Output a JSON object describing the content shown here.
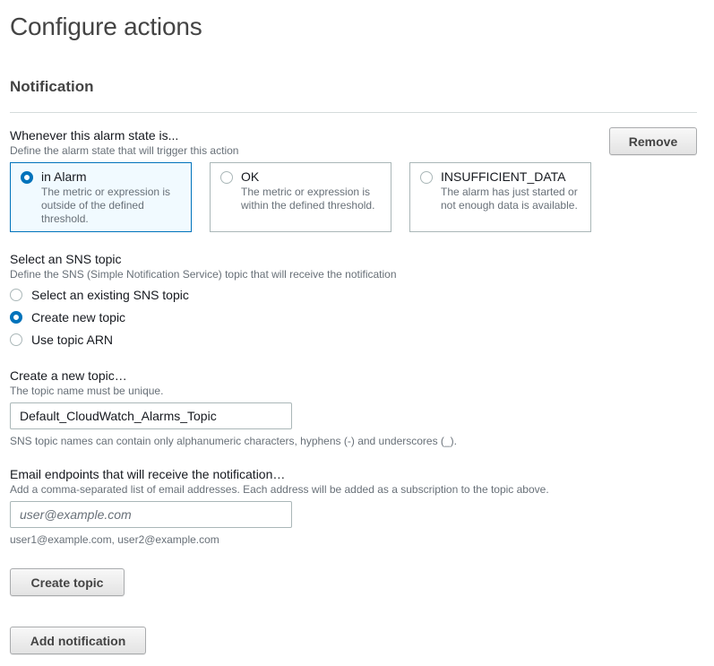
{
  "page": {
    "title": "Configure actions"
  },
  "notification": {
    "section_title": "Notification",
    "remove_label": "Remove",
    "alarm_state": {
      "label": "Whenever this alarm state is...",
      "description": "Define the alarm state that will trigger this action",
      "selected": "in Alarm",
      "options": [
        {
          "title": "in Alarm",
          "description": "The metric or expression is outside of the defined threshold."
        },
        {
          "title": "OK",
          "description": "The metric or expression is within the defined threshold."
        },
        {
          "title": "INSUFFICIENT_DATA",
          "description": "The alarm has just started or not enough data is available."
        }
      ]
    },
    "sns_topic": {
      "label": "Select an SNS topic",
      "description": "Define the SNS (Simple Notification Service) topic that will receive the notification",
      "selected": "Create new topic",
      "options": [
        {
          "label": "Select an existing SNS topic"
        },
        {
          "label": "Create new topic"
        },
        {
          "label": "Use topic ARN"
        }
      ]
    },
    "new_topic": {
      "label": "Create a new topic…",
      "description": "The topic name must be unique.",
      "value": "Default_CloudWatch_Alarms_Topic",
      "constraint": "SNS topic names can contain only alphanumeric characters, hyphens (-) and underscores (_)."
    },
    "email_endpoints": {
      "label": "Email endpoints that will receive the notification…",
      "description": "Add a comma-separated list of email addresses. Each address will be added as a subscription to the topic above.",
      "value": "",
      "placeholder": "user@example.com",
      "hint": "user1@example.com, user2@example.com"
    },
    "create_topic_label": "Create topic",
    "add_notification_label": "Add notification"
  },
  "colors": {
    "accent": "#0073bb",
    "selected_tile_background": "#f1faff",
    "border": "#aab7b8",
    "muted_text": "#687078"
  }
}
